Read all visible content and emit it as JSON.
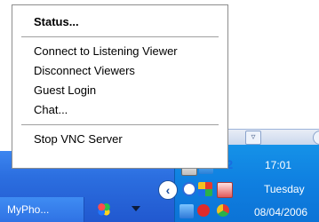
{
  "menu": {
    "items": [
      {
        "label": "Status...",
        "bold": true
      },
      {
        "separator": true
      },
      {
        "label": "Connect to Listening Viewer"
      },
      {
        "label": "Disconnect Viewers"
      },
      {
        "label": "Guest Login"
      },
      {
        "label": "Chat..."
      },
      {
        "separator": true
      },
      {
        "label": "Stop VNC Server"
      }
    ]
  },
  "taskbar": {
    "button_label": "MyPho...",
    "tray": {
      "time": "17:01",
      "day": "Tuesday",
      "date": "08/04/2006"
    }
  },
  "colors": {
    "taskbar_blue": "#2c6fe0",
    "tray_blue": "#0f7fe0",
    "menu_border": "#8d8d8d"
  },
  "icons": {
    "tray": [
      "computer-icon",
      "network-icon",
      "vnc-icon",
      "back-icon",
      "refresh-icon",
      "windows-flag-icon",
      "antivirus-icon",
      "network-monitor-icon",
      "red-circle-icon",
      "chrome-like-icon"
    ],
    "taskbar": [
      "butterfly-icon",
      "arrow-down-icon"
    ]
  }
}
